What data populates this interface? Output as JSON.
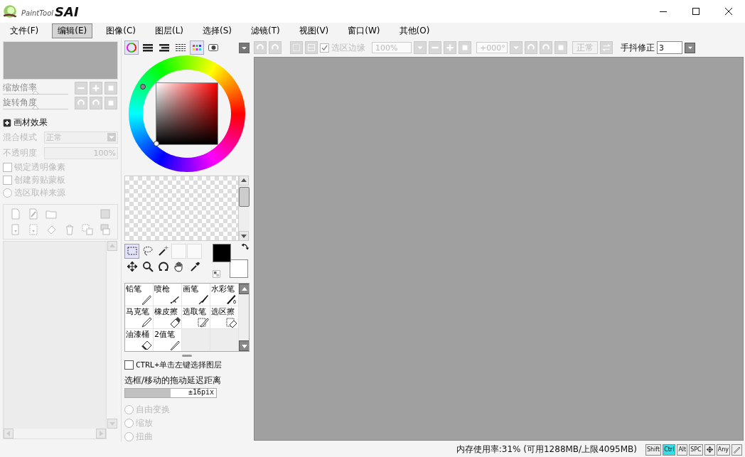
{
  "window": {
    "logo_small": "PaintTool",
    "logo_big": "SAI"
  },
  "menu": [
    {
      "label": "文件(F)",
      "selected": false
    },
    {
      "label": "编辑(E)",
      "selected": true
    },
    {
      "label": "图像(C)",
      "selected": false
    },
    {
      "label": "图层(L)",
      "selected": false
    },
    {
      "label": "选择(S)",
      "selected": false
    },
    {
      "label": "滤镜(T)",
      "selected": false
    },
    {
      "label": "视图(V)",
      "selected": false
    },
    {
      "label": "窗口(W)",
      "selected": false
    },
    {
      "label": "其他(O)",
      "selected": false
    }
  ],
  "navigator": {
    "zoom": {
      "label": "缩放倍率",
      "level": 0.5
    },
    "rotate": {
      "label": "旋转角度",
      "level": 0.5
    }
  },
  "layer_panel": {
    "effect_label": "画材效果",
    "blend_label": "混合模式",
    "blend_value": "正常",
    "opacity_label": "不透明度",
    "opacity_value": "100%",
    "options": [
      {
        "kind": "checkbox",
        "label": "锁定透明像素",
        "checked": false
      },
      {
        "kind": "checkbox",
        "label": "创建剪贴蒙板",
        "checked": false
      },
      {
        "kind": "radio",
        "label": "选区取样来源",
        "checked": false
      }
    ]
  },
  "color_modes": [
    {
      "kind": "wheel",
      "selected": true
    },
    {
      "kind": "rgb",
      "selected": false
    },
    {
      "kind": "hsv",
      "selected": false
    },
    {
      "kind": "mixer",
      "selected": false
    },
    {
      "kind": "swatches",
      "selected": true
    },
    {
      "kind": "scratch",
      "selected": false
    }
  ],
  "tools": [
    {
      "kind": "marquee",
      "selected": true
    },
    {
      "kind": "lasso",
      "selected": false
    },
    {
      "kind": "wand",
      "selected": false
    },
    {
      "kind": "blank",
      "selected": false
    },
    {
      "kind": "blank",
      "selected": false
    },
    {
      "kind": "move",
      "selected": false
    },
    {
      "kind": "zoom",
      "selected": false
    },
    {
      "kind": "rotate",
      "selected": false
    },
    {
      "kind": "hand",
      "selected": false
    },
    {
      "kind": "eyedropper",
      "selected": false
    }
  ],
  "brushes": [
    {
      "kind": "pencil",
      "label": "铅笔"
    },
    {
      "kind": "airbrush",
      "label": "喷枪"
    },
    {
      "kind": "brush",
      "label": "画笔"
    },
    {
      "kind": "watercolor",
      "label": "水彩笔"
    },
    {
      "kind": "marker",
      "label": "马克笔"
    },
    {
      "kind": "eraser",
      "label": "橡皮擦"
    },
    {
      "kind": "selpen",
      "label": "选取笔"
    },
    {
      "kind": "selerase",
      "label": "选区擦"
    },
    {
      "kind": "bucket",
      "label": "油漆桶"
    },
    {
      "kind": "binary",
      "label": "2值笔"
    }
  ],
  "options": {
    "ctrl_label": "CTRL+单击左键选择图层",
    "ctrl_checked": false,
    "drag_label": "选框/移动的拖动延迟距离",
    "drag_value": "±16pix",
    "level": 0.5,
    "transforms": [
      {
        "label": "自由变换",
        "selected": false
      },
      {
        "label": "缩放",
        "selected": false
      },
      {
        "label": "扭曲",
        "selected": false
      }
    ]
  },
  "toolbar": {
    "edge_label": "选区边缘",
    "edge_checked": true,
    "zoom": "100%",
    "angle": "+000°",
    "blend": "正常",
    "stabilizer_label": "手抖修正",
    "stabilizer_value": "3"
  },
  "status": {
    "memory": "内存使用率:31% (可用1288MB/上限4095MB)",
    "keys": [
      {
        "kind": "text",
        "label": "Shift",
        "on": false
      },
      {
        "kind": "text",
        "label": "Ctrl",
        "on": true
      },
      {
        "kind": "text",
        "label": "Alt",
        "on": false
      },
      {
        "kind": "text",
        "label": "SPC",
        "on": false
      },
      {
        "kind": "move",
        "on": false
      },
      {
        "kind": "text",
        "label": "Any",
        "on": false
      },
      {
        "kind": "pen",
        "on": false
      }
    ]
  }
}
